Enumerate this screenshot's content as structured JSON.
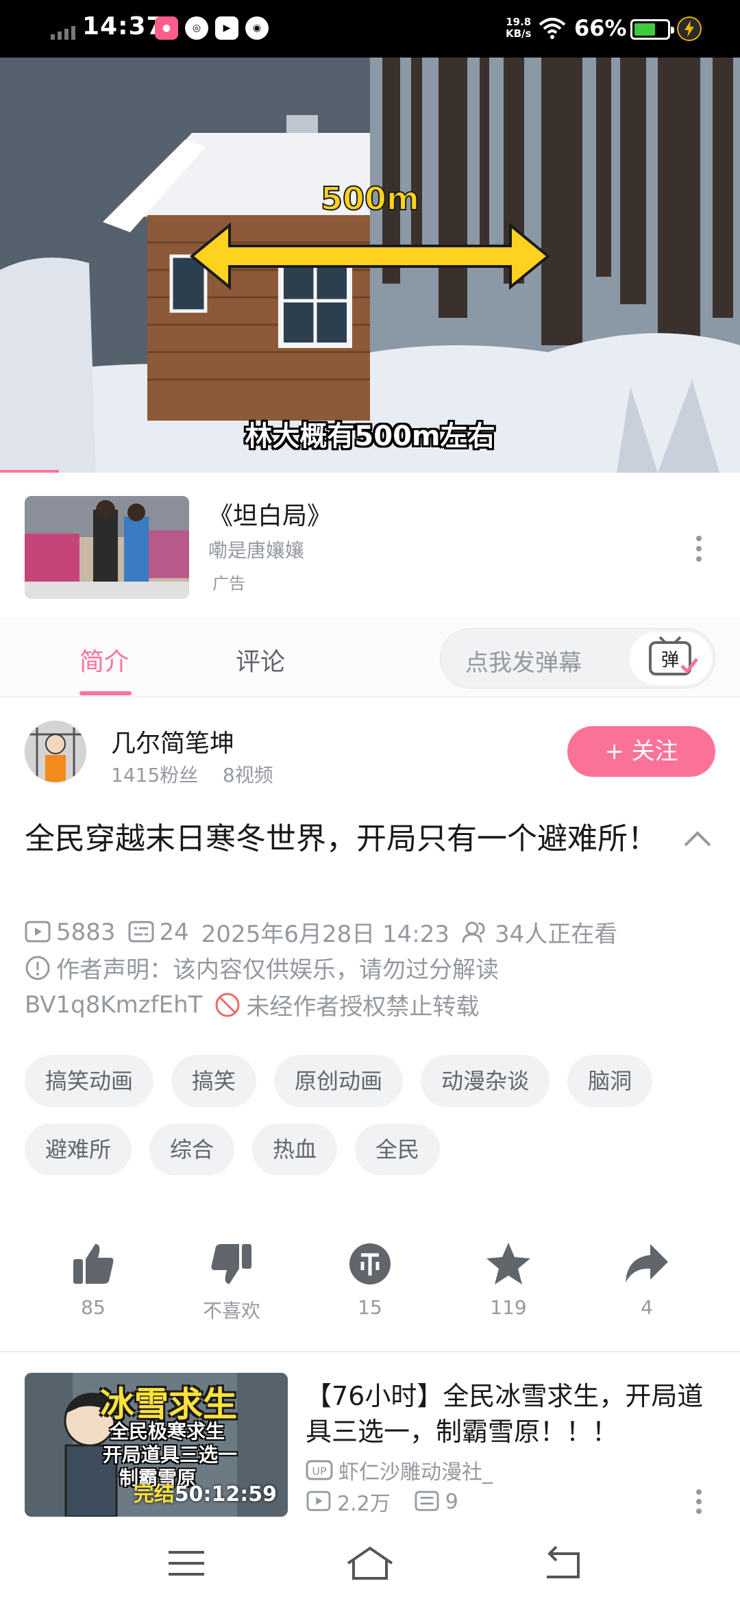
{
  "status_bar": {
    "time": "14:37",
    "net_speed_value": "19.8",
    "net_speed_unit": "KB/s",
    "battery_percent": "66%",
    "battery_level": 0.66
  },
  "video": {
    "overlay_label": "500m",
    "subtitle": "林大概有500m左右",
    "progress_fraction": 0.08
  },
  "ad": {
    "title": "《坦白局》",
    "author": "嘞是唐孃孃",
    "tag": "广告"
  },
  "tabs": {
    "intro": "简介",
    "comments": "评论",
    "danmaku_placeholder": "点我发弹幕",
    "danmaku_button": "弹"
  },
  "uploader": {
    "name": "几尔简笔坤",
    "followers": "1415粉丝",
    "videos": "8视频",
    "follow_button": "+ 关注"
  },
  "video_info": {
    "title": "全民穿越末日寒冬世界，开局只有一个避难所！",
    "plays": "5883",
    "danmaku_count": "24",
    "publish_time": "2025年6月28日 14:23",
    "watching": "34人正在看",
    "declaration": "作者声明：该内容仅供娱乐，请勿过分解读",
    "bvid": "BV1q8KmzfEhT",
    "repost_notice": "未经作者授权禁止转载"
  },
  "tags": [
    "搞笑动画",
    "搞笑",
    "原创动画",
    "动漫杂谈",
    "脑洞",
    "避难所",
    "综合",
    "热血",
    "全民"
  ],
  "actions": {
    "like": "85",
    "dislike": "不喜欢",
    "coin": "15",
    "favorite": "119",
    "share": "4"
  },
  "recommended": {
    "title": "【76小时】全民冰雪求生，开局道具三选一，制霸雪原！！！",
    "uploader": "虾仁沙雕动漫社_",
    "plays": "2.2万",
    "danmaku": "9",
    "duration": "50:12:59",
    "thumb_big_text": "冰雪求生",
    "thumb_line1": "全民极寒求生",
    "thumb_line2": "开局道具三选一",
    "thumb_line3": "制霸雪原",
    "thumb_tag": "完结"
  },
  "icons": {
    "play_count": "play-count-icon",
    "danmaku": "danmaku-icon",
    "watching": "watching-icon",
    "notice": "notice-icon",
    "forbid": "forbid-icon",
    "like": "thumbs-up-icon",
    "dislike": "thumbs-down-icon",
    "coin": "coin-icon",
    "favorite": "star-icon",
    "share": "share-icon"
  },
  "colors": {
    "accent": "#fb7299",
    "text_primary": "#18191c",
    "text_secondary": "#9499a0",
    "tag_bg": "#f1f2f3"
  }
}
